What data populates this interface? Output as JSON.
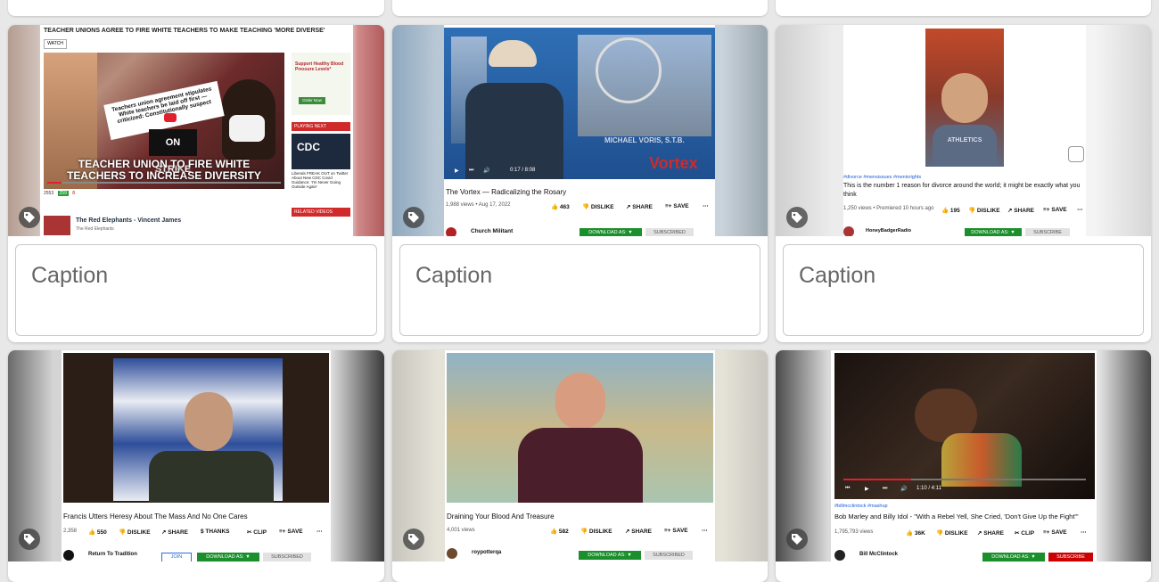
{
  "cards": [
    {
      "caption_placeholder": "Caption",
      "headline": "TEACHER UNIONS AGREE TO FIRE WHITE TEACHERS TO MAKE TEACHING 'MORE DIVERSE'",
      "watch_label": "WATCH",
      "sign_text": "Teachers union agreement stipulates White teachers be laid off first — criticized: Constitutionally suspect",
      "strike_text": "ON STRIKE",
      "banner_text_1": "TEACHER UNION TO FIRE WHITE",
      "banner_text_2": "TEACHERS TO INCREASE DIVERSITY",
      "ad_title": "Support Healthy Blood Pressure Levels*",
      "ad_button": "Order Now",
      "playing_next": "PLAYING NEXT",
      "related_videos": "RELATED VIDEOS",
      "side_headline": "Liberals FREAK OUT on Twitter About New CDC Covid Guidance: 'I'm Never Going Outside Again'",
      "cdc_label": "CDC",
      "views": "2553",
      "likes": "259",
      "dislikes": "8",
      "channel": "The Red Elephants - Vincent James",
      "channel_sub": "The Red Elephants"
    },
    {
      "caption_placeholder": "Caption",
      "title": "The Vortex — Radicalizing the Rosary",
      "meta": "1,988 views • Aug 17, 2022",
      "likes": "463",
      "dislike": "DISLIKE",
      "share": "SHARE",
      "save": "SAVE",
      "channel": "Church Militant",
      "download": "DOWNLOAD AS: ▼",
      "subscribe": "SUBSCRIBED",
      "time": "0:17 / 8:08",
      "logo_text": "Vortex",
      "lower_third": "MICHAEL VORIS, S.T.B."
    },
    {
      "caption_placeholder": "Caption",
      "hashtags": "#divorce #mensissues #menisrights",
      "title": "This is the number 1 reason for divorce around the world; it might be exactly what you think",
      "meta": "1,250 views • Premiered 10 hours ago",
      "likes": "195",
      "dislike": "DISLIKE",
      "share": "SHARE",
      "save": "SAVE",
      "channel": "HoneyBadgerRadio",
      "download": "DOWNLOAD AS: ▼",
      "subscribe": "SUBSCRIBE",
      "shirt_text": "ATHLETICS"
    },
    {
      "title": "Francis Utters Heresy About The Mass And No One Cares",
      "meta": "2,358",
      "likes": "550",
      "dislike": "DISLIKE",
      "share": "SHARE",
      "thanks": "THANKS",
      "clip": "CLIP",
      "save": "SAVE",
      "channel": "Return To Tradition",
      "join": "JOIN",
      "download": "DOWNLOAD AS: ▼",
      "subscribe": "SUBSCRIBED"
    },
    {
      "title": "Draining Your Blood And Treasure",
      "meta": "4,001 views",
      "likes": "582",
      "dislike": "DISLIKE",
      "share": "SHARE",
      "save": "SAVE",
      "channel": "roypotterqa",
      "download": "DOWNLOAD AS: ▼",
      "subscribe": "SUBSCRIBED"
    },
    {
      "hashtags": "#billmcclintock #mashup",
      "title": "Bob Marley and Billy Idol - \"With a Rebel Yell, She Cried, 'Don't Give Up the Fight'\"",
      "meta": "1,795,793 views",
      "likes": "36K",
      "dislike": "DISLIKE",
      "share": "SHARE",
      "clip": "CLIP",
      "save": "SAVE",
      "channel": "Bill McClintock",
      "download": "DOWNLOAD AS: ▼",
      "subscribe": "SUBSCRIBE",
      "time": "1:10 / 4:11"
    }
  ],
  "colors": {
    "page_bg": "#e8e8e8",
    "card_bg": "#ffffff",
    "download_green": "#1a8f2b",
    "subscribe_red": "#cc0000",
    "caption_text": "#666666"
  },
  "icons": {
    "tag": "tag-icon",
    "like": "thumbs-up-icon",
    "dislike": "thumbs-down-icon",
    "share": "share-icon",
    "save": "save-icon",
    "more": "more-icon"
  }
}
